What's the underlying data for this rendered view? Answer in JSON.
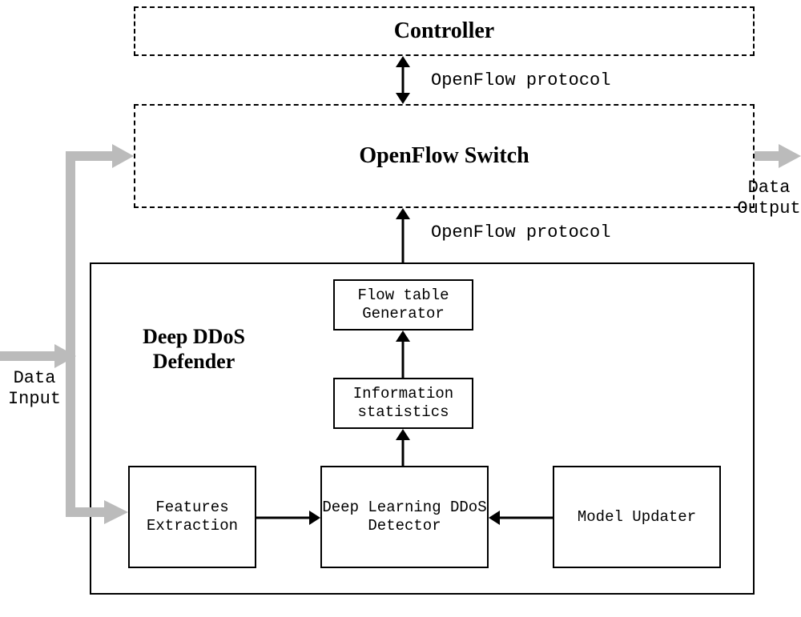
{
  "nodes": {
    "controller": "Controller",
    "openflow_switch": "OpenFlow Switch",
    "defender_title": "Deep DDoS Defender",
    "flow_table_generator": "Flow table Generator",
    "information_statistics": "Information statistics",
    "features_extraction": "Features Extraction",
    "ddos_detector": "Deep Learning DDoS Detector",
    "model_updater": "Model Updater"
  },
  "edges": {
    "openflow_protocol_top": "OpenFlow protocol",
    "openflow_protocol_mid": "OpenFlow protocol"
  },
  "io": {
    "data_input": "Data Input",
    "data_output": "Data Output"
  }
}
